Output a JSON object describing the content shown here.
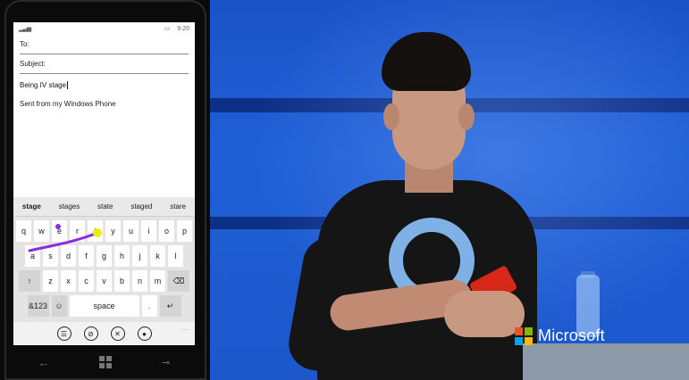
{
  "phone": {
    "status": {
      "signal_icon": "signal-bars-icon",
      "battery_icon": "battery-icon",
      "time": "9:20"
    },
    "email": {
      "to_label": "To:",
      "subject_label": "Subject:",
      "body": "Being IV stage",
      "signature": "Sent from my Windows Phone"
    },
    "keyboard": {
      "suggestions": [
        "stage",
        "stages",
        "state",
        "staged",
        "stare"
      ],
      "row1": [
        "q",
        "w",
        "e",
        "r",
        "t",
        "y",
        "u",
        "i",
        "o",
        "p"
      ],
      "row2": [
        "a",
        "s",
        "d",
        "f",
        "g",
        "h",
        "j",
        "k",
        "l"
      ],
      "row3_keys": [
        "z",
        "x",
        "c",
        "v",
        "b",
        "n",
        "m"
      ],
      "shift_icon": "↑",
      "backspace_icon": "⌫",
      "num_key": "&123",
      "emoji_icon": "☺",
      "space_label": "space",
      "period": ".",
      "enter_icon": "↵",
      "swipe_color": "#8a2be2",
      "swipe_end_color": "#e8f000"
    },
    "appbar": {
      "more": "...",
      "icons": [
        "attach-contact-icon",
        "attach-file-icon",
        "discard-icon",
        "voice-icon"
      ]
    },
    "hardware": {
      "back_icon": "back-arrow-icon",
      "start_icon": "windows-logo-icon",
      "search_icon": "search-icon"
    }
  },
  "stage": {
    "brand_text": "Microsoft",
    "brand_colors": [
      "#f25022",
      "#7fba00",
      "#00a4ef",
      "#ffb900"
    ],
    "background": "#1f5fd6"
  }
}
